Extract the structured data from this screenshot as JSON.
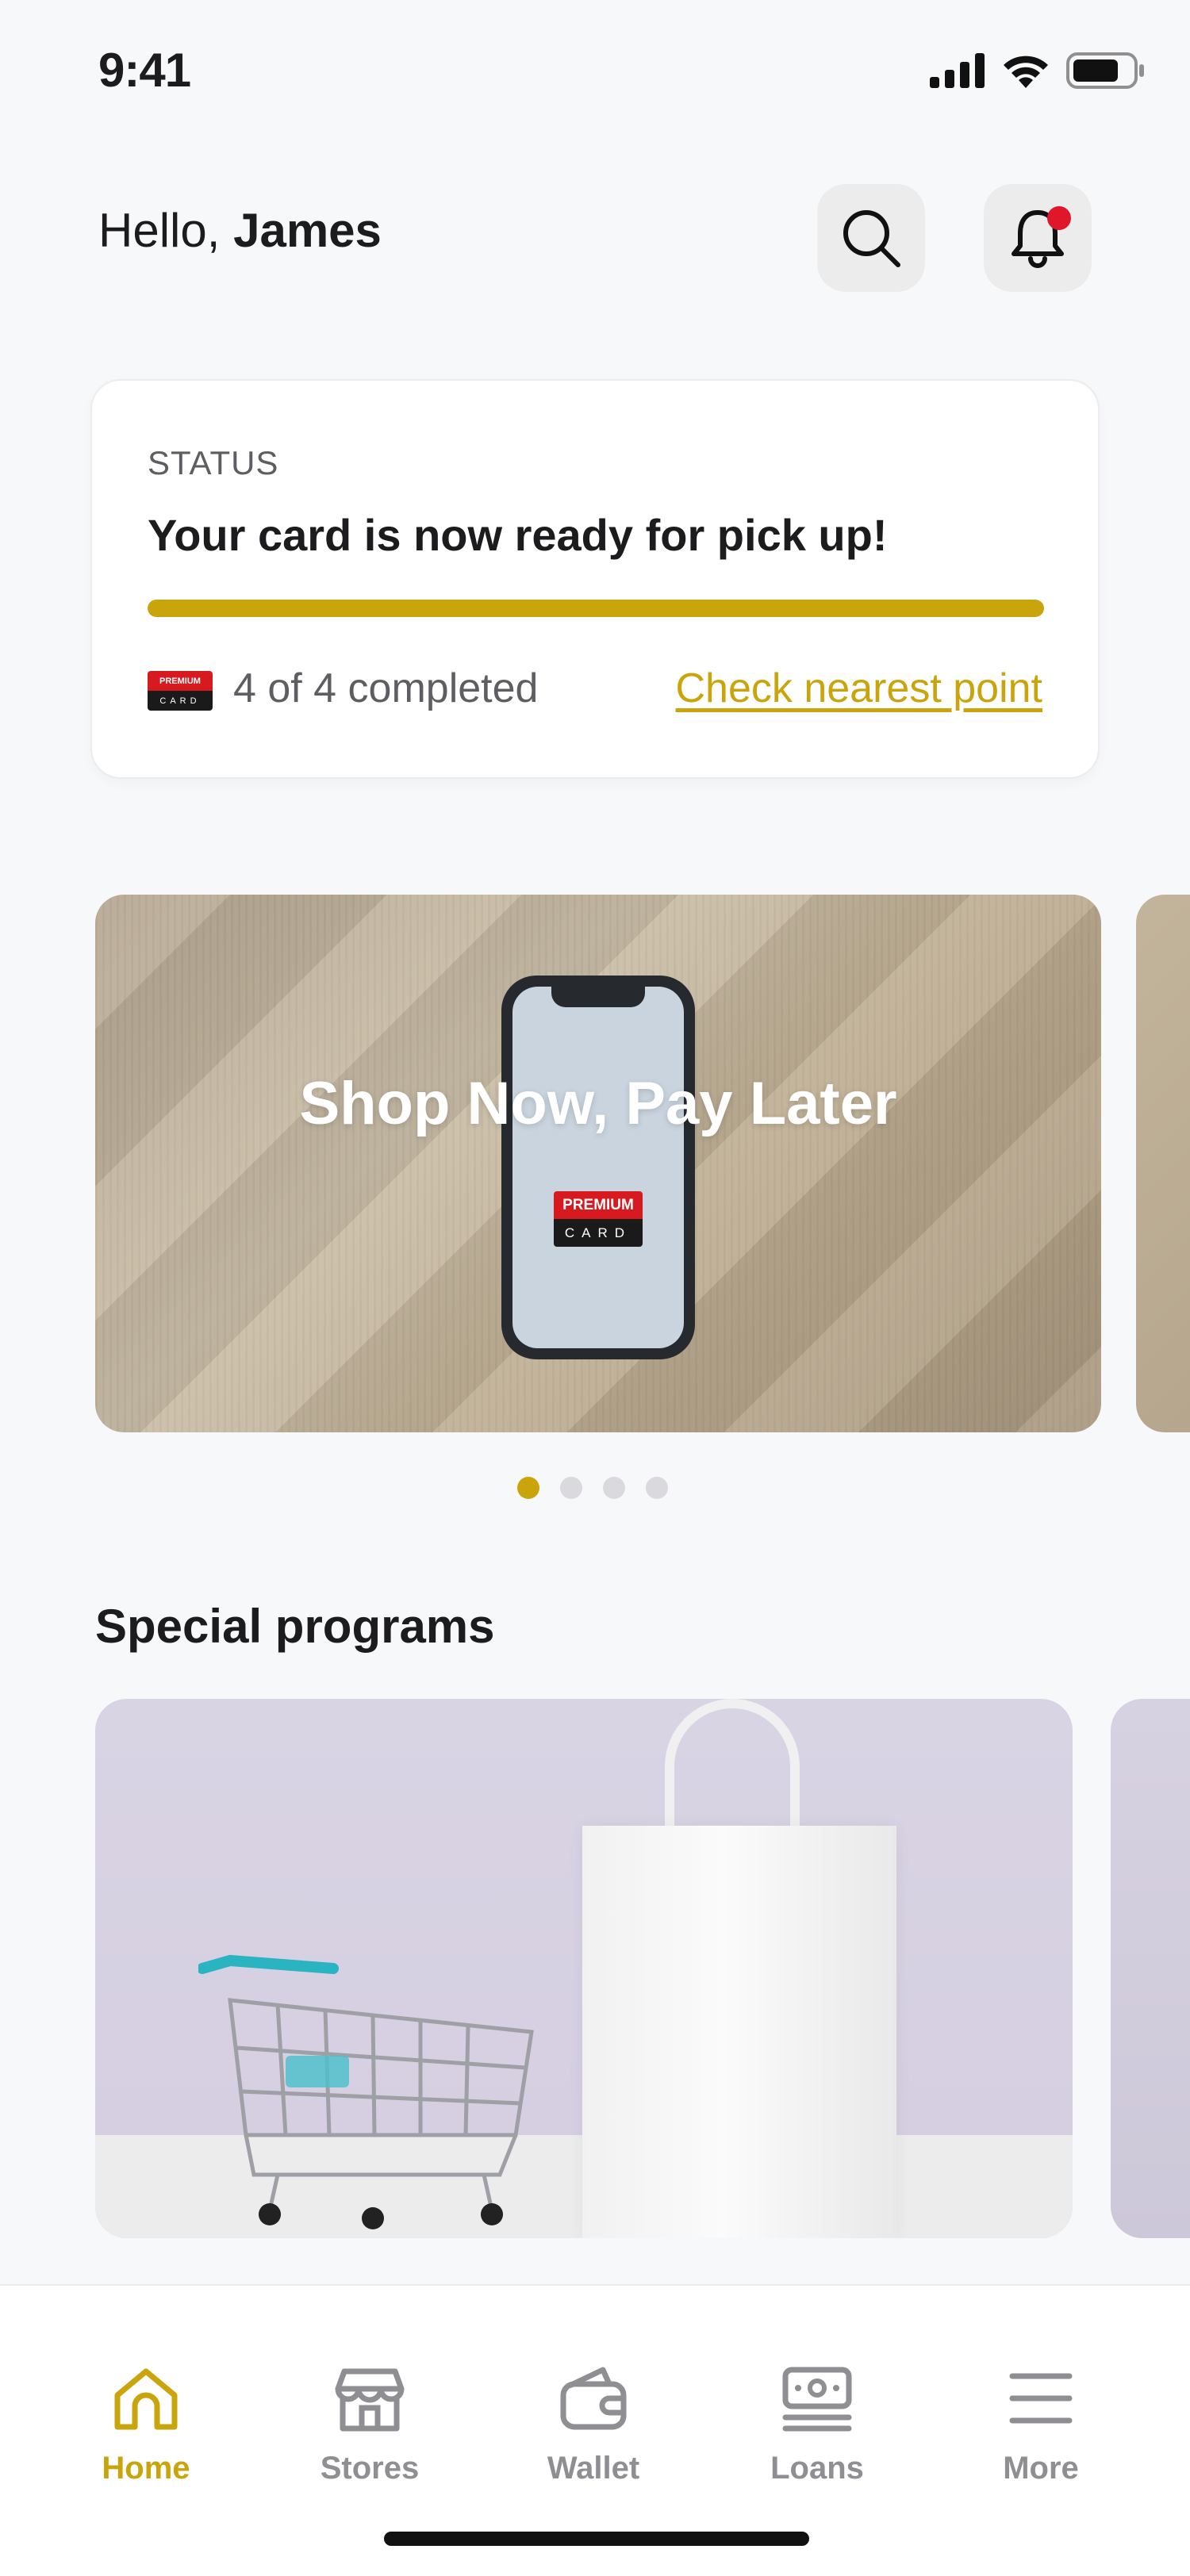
{
  "status_bar": {
    "time": "9:41"
  },
  "header": {
    "greeting_prefix": "Hello,",
    "user_name": "James"
  },
  "status_card": {
    "label": "STATUS",
    "title": "Your card is now ready for pick up!",
    "progress_fraction": 1.0,
    "completed_text": "4 of 4 completed",
    "link_text": "Check nearest point",
    "logo_top": "PREMIUM",
    "logo_bottom": "CARD"
  },
  "banner": {
    "title": "Shop Now, Pay Later",
    "logo_top": "PREMIUM",
    "logo_bottom": "CARD",
    "dots_total": 4,
    "dots_active_index": 0
  },
  "special_programs": {
    "title": "Special programs"
  },
  "tabbar": {
    "items": [
      {
        "label": "Home",
        "icon": "home-icon",
        "active": true
      },
      {
        "label": "Stores",
        "icon": "store-icon",
        "active": false
      },
      {
        "label": "Wallet",
        "icon": "wallet-icon",
        "active": false
      },
      {
        "label": "Loans",
        "icon": "loans-icon",
        "active": false
      },
      {
        "label": "More",
        "icon": "menu-icon",
        "active": false
      }
    ]
  },
  "colors": {
    "accent": "#c9a40a",
    "notification": "#e0162b",
    "brand_red": "#d71920"
  }
}
